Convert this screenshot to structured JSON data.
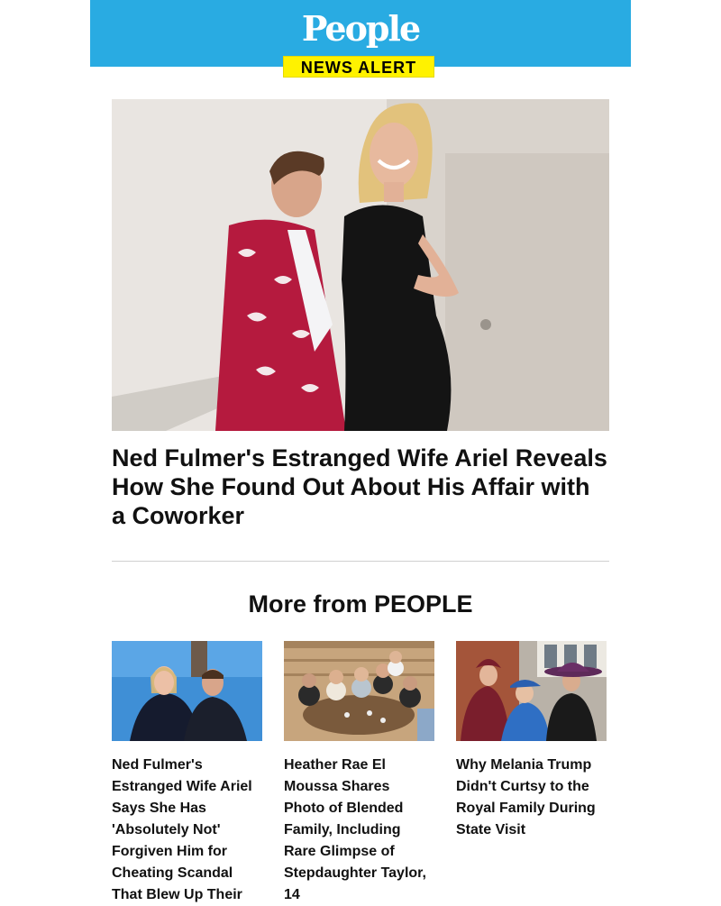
{
  "header": {
    "logo_text": "People",
    "badge": "NEWS ALERT",
    "bg_color": "#29abe2",
    "badge_color": "#fff200"
  },
  "hero": {
    "headline": "Ned Fulmer's Estranged Wife Ariel Reveals How She Found Out About His Affair with a Coworker"
  },
  "more": {
    "title": "More from PEOPLE",
    "articles": [
      {
        "title": "Ned Fulmer's Estranged Wife Ariel Says She Has 'Absolutely Not' Forgiven Him for Cheating Scandal That Blew Up Their"
      },
      {
        "title": "Heather Rae El Moussa Shares Photo of Blended Family, Including Rare Glimpse of Stepdaughter Taylor, 14"
      },
      {
        "title": "Why Melania Trump Didn't Curtsy to the Royal Family During State Visit"
      }
    ]
  }
}
